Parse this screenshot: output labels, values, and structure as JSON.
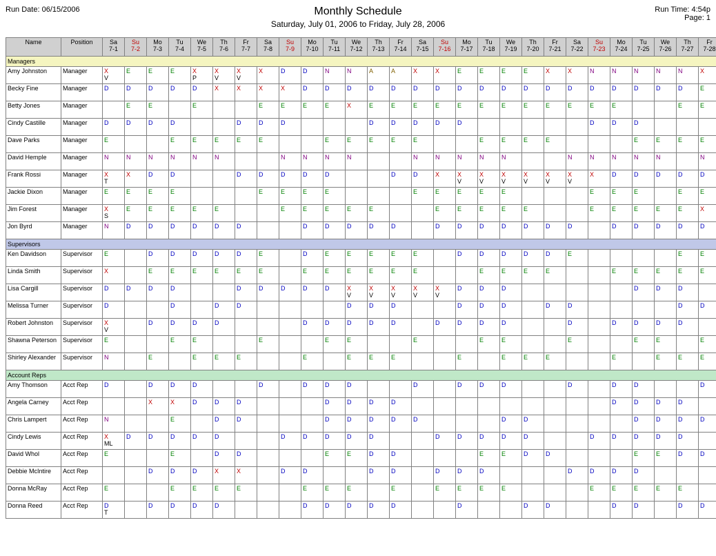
{
  "header": {
    "runDateLabel": "Run Date: 06/15/2006",
    "runTimeLabel": "Run Time: 4:54p",
    "pageLabel": "Page: 1",
    "title": "Monthly Schedule",
    "subtitle": "Saturday, July 01, 2006 to Friday, July 28, 2006"
  },
  "cols": {
    "name": "Name",
    "position": "Position"
  },
  "days": [
    {
      "dow": "Sa",
      "md": "7-1",
      "su": false
    },
    {
      "dow": "Su",
      "md": "7-2",
      "su": true
    },
    {
      "dow": "Mo",
      "md": "7-3",
      "su": false
    },
    {
      "dow": "Tu",
      "md": "7-4",
      "su": false
    },
    {
      "dow": "We",
      "md": "7-5",
      "su": false
    },
    {
      "dow": "Th",
      "md": "7-6",
      "su": false
    },
    {
      "dow": "Fr",
      "md": "7-7",
      "su": false
    },
    {
      "dow": "Sa",
      "md": "7-8",
      "su": false
    },
    {
      "dow": "Su",
      "md": "7-9",
      "su": true
    },
    {
      "dow": "Mo",
      "md": "7-10",
      "su": false
    },
    {
      "dow": "Tu",
      "md": "7-11",
      "su": false
    },
    {
      "dow": "We",
      "md": "7-12",
      "su": false
    },
    {
      "dow": "Th",
      "md": "7-13",
      "su": false
    },
    {
      "dow": "Fr",
      "md": "7-14",
      "su": false
    },
    {
      "dow": "Sa",
      "md": "7-15",
      "su": false
    },
    {
      "dow": "Su",
      "md": "7-16",
      "su": true
    },
    {
      "dow": "Mo",
      "md": "7-17",
      "su": false
    },
    {
      "dow": "Tu",
      "md": "7-18",
      "su": false
    },
    {
      "dow": "We",
      "md": "7-19",
      "su": false
    },
    {
      "dow": "Th",
      "md": "7-20",
      "su": false
    },
    {
      "dow": "Fr",
      "md": "7-21",
      "su": false
    },
    {
      "dow": "Sa",
      "md": "7-22",
      "su": false
    },
    {
      "dow": "Su",
      "md": "7-23",
      "su": true
    },
    {
      "dow": "Mo",
      "md": "7-24",
      "su": false
    },
    {
      "dow": "Tu",
      "md": "7-25",
      "su": false
    },
    {
      "dow": "We",
      "md": "7-26",
      "su": false
    },
    {
      "dow": "Th",
      "md": "7-27",
      "su": false
    },
    {
      "dow": "Fr",
      "md": "7-28",
      "su": false
    }
  ],
  "groups": [
    {
      "label": "Managers",
      "cls": "g0",
      "rows": [
        {
          "name": "Amy Johnston",
          "pos": "Manager",
          "c": [
            "X V",
            "E",
            "E",
            "E",
            "X P",
            "X V",
            "X V",
            "X",
            "D",
            "D",
            "N",
            "N",
            "A",
            "A",
            "X",
            "X",
            "E",
            "E",
            "E",
            "E",
            "X",
            "X",
            "N",
            "N",
            "N",
            "N",
            "N",
            "X"
          ]
        },
        {
          "name": "Becky Fine",
          "pos": "Manager",
          "c": [
            "D",
            "D",
            "D",
            "D",
            "D",
            "X",
            "X",
            "X",
            "X",
            "D",
            "D",
            "D",
            "D",
            "D",
            "D",
            "D",
            "D",
            "D",
            "D",
            "D",
            "D",
            "D",
            "D",
            "D",
            "D",
            "D",
            "D",
            "E"
          ]
        },
        {
          "name": "Betty Jones",
          "pos": "Manager",
          "c": [
            "",
            "E",
            "E",
            "",
            "E",
            "",
            "",
            "E",
            "E",
            "E",
            "E",
            "X",
            "E",
            "E",
            "E",
            "E",
            "E",
            "E",
            "E",
            "E",
            "E",
            "E",
            "E",
            "E",
            "",
            "",
            "E",
            "E"
          ]
        },
        {
          "name": "Cindy Castille",
          "pos": "Manager",
          "c": [
            "D",
            "D",
            "D",
            "D",
            "",
            "",
            "D",
            "D",
            "D",
            "",
            "",
            "",
            "D",
            "D",
            "D",
            "D",
            "D",
            "",
            "",
            "",
            "",
            "",
            "D",
            "D",
            "D",
            "",
            "",
            ""
          ]
        },
        {
          "name": "Dave Parks",
          "pos": "Manager",
          "c": [
            "E",
            "",
            "",
            "E",
            "E",
            "E",
            "E",
            "E",
            "",
            "",
            "E",
            "E",
            "E",
            "E",
            "E",
            "",
            "",
            "E",
            "E",
            "E",
            "E",
            "",
            "",
            "",
            "E",
            "E",
            "E",
            "E"
          ]
        },
        {
          "name": "David Hemple",
          "pos": "Manager",
          "c": [
            "N",
            "N",
            "N",
            "N",
            "N",
            "N",
            "",
            "",
            "N",
            "N",
            "N",
            "N",
            "",
            "",
            "N",
            "N",
            "N",
            "N",
            "N",
            "",
            "",
            "N",
            "N",
            "N",
            "N",
            "N",
            "",
            "N"
          ]
        },
        {
          "name": "Frank Rossi",
          "pos": "Manager",
          "c": [
            "X T",
            "X",
            "D",
            "D",
            "",
            "",
            "D",
            "D",
            "D",
            "D",
            "D",
            "",
            "",
            "D",
            "D",
            "X",
            "X V",
            "X V",
            "X V",
            "X V",
            "X V",
            "X V",
            "X",
            "D",
            "D",
            "D",
            "D",
            "D"
          ]
        },
        {
          "name": "Jackie Dixon",
          "pos": "Manager",
          "c": [
            "E",
            "E",
            "E",
            "E",
            "",
            "",
            "",
            "E",
            "E",
            "E",
            "E",
            "",
            "",
            "",
            "E",
            "E",
            "E",
            "E",
            "E",
            "",
            "",
            "",
            "E",
            "E",
            "E",
            "",
            "E",
            "E"
          ]
        },
        {
          "name": "Jim Forest",
          "pos": "Manager",
          "c": [
            "X S",
            "E",
            "E",
            "E",
            "E",
            "E",
            "",
            "",
            "E",
            "E",
            "E",
            "E",
            "E",
            "",
            "",
            "E",
            "E",
            "E",
            "E",
            "E",
            "",
            "",
            "E",
            "E",
            "E",
            "E",
            "E",
            "X"
          ]
        },
        {
          "name": "Jon Byrd",
          "pos": "Manager",
          "c": [
            "N",
            "D",
            "D",
            "D",
            "D",
            "D",
            "D",
            "",
            "",
            "D",
            "D",
            "D",
            "D",
            "D",
            "",
            "D",
            "D",
            "D",
            "D",
            "D",
            "D",
            "D",
            "",
            "D",
            "D",
            "D",
            "D",
            "D"
          ]
        }
      ]
    },
    {
      "label": "Supervisors",
      "cls": "g1",
      "rows": [
        {
          "name": "Ken Davidson",
          "pos": "Supervisor",
          "c": [
            "E",
            "",
            "D",
            "D",
            "D",
            "D",
            "D",
            "E",
            "",
            "D",
            "E",
            "E",
            "E",
            "E",
            "E",
            "",
            "D",
            "D",
            "D",
            "D",
            "D",
            "E",
            "",
            "",
            "",
            "",
            "E",
            "E"
          ]
        },
        {
          "name": "Linda Smith",
          "pos": "Supervisor",
          "c": [
            "X",
            "",
            "E",
            "E",
            "E",
            "E",
            "E",
            "E",
            "",
            "E",
            "E",
            "E",
            "E",
            "E",
            "E",
            "",
            "",
            "E",
            "E",
            "E",
            "E",
            "",
            "",
            "E",
            "E",
            "E",
            "E",
            "E"
          ]
        },
        {
          "name": "Lisa Cargill",
          "pos": "Supervisor",
          "c": [
            "D",
            "D",
            "D",
            "D",
            "",
            "",
            "D",
            "D",
            "D",
            "D",
            "D",
            "X V",
            "X V",
            "X V",
            "X V",
            "X V",
            "D",
            "D",
            "D",
            "",
            "",
            "",
            "",
            "",
            "D",
            "D",
            "D",
            ""
          ]
        },
        {
          "name": "Melissa Turner",
          "pos": "Supervisor",
          "c": [
            "D",
            "",
            "",
            "D",
            "",
            "D",
            "D",
            "",
            "",
            "",
            "",
            "D",
            "D",
            "D",
            "",
            "",
            "D",
            "D",
            "D",
            "",
            "D",
            "D",
            "",
            "",
            "",
            "",
            "D",
            "D"
          ]
        },
        {
          "name": "Robert Johnston",
          "pos": "Supervisor",
          "c": [
            "X V",
            "",
            "D",
            "D",
            "D",
            "D",
            "",
            "",
            "",
            "D",
            "D",
            "D",
            "D",
            "D",
            "",
            "D",
            "D",
            "D",
            "D",
            "",
            "",
            "D",
            "",
            "D",
            "D",
            "D",
            "D",
            ""
          ]
        },
        {
          "name": "Shawna Peterson",
          "pos": "Supervisor",
          "c": [
            "E",
            "",
            "",
            "E",
            "E",
            "",
            "",
            "E",
            "",
            "",
            "E",
            "E",
            "",
            "",
            "E",
            "",
            "",
            "E",
            "E",
            "",
            "",
            "E",
            "",
            "",
            "E",
            "E",
            "",
            "E"
          ]
        },
        {
          "name": "Shirley Alexander",
          "pos": "Supervisor",
          "c": [
            "N",
            "",
            "E",
            "",
            "E",
            "E",
            "E",
            "",
            "",
            "E",
            "",
            "E",
            "E",
            "E",
            "",
            "",
            "E",
            "",
            "E",
            "E",
            "E",
            "",
            "",
            "E",
            "",
            "E",
            "E",
            "E"
          ]
        }
      ]
    },
    {
      "label": "Account Reps",
      "cls": "g2",
      "rows": [
        {
          "name": "Amy Thomson",
          "pos": "Acct Rep",
          "c": [
            "D",
            "",
            "D",
            "D",
            "D",
            "",
            "",
            "D",
            "",
            "D",
            "D",
            "D",
            "",
            "",
            "D",
            "",
            "D",
            "D",
            "D",
            "",
            "",
            "D",
            "",
            "D",
            "D",
            "",
            "",
            "D"
          ]
        },
        {
          "name": "Angela Carney",
          "pos": "Acct Rep",
          "c": [
            "",
            "",
            "X",
            "X",
            "D",
            "D",
            "D",
            "",
            "",
            "",
            "D",
            "D",
            "D",
            "D",
            "",
            "",
            "",
            "",
            "",
            "",
            "",
            "",
            "",
            "D",
            "D",
            "D",
            "D",
            ""
          ]
        },
        {
          "name": "Chris Lampert",
          "pos": "Acct Rep",
          "c": [
            "N",
            "",
            "",
            "E",
            "",
            "D",
            "D",
            "",
            "",
            "",
            "D",
            "D",
            "D",
            "D",
            "D",
            "",
            "",
            "",
            "D",
            "D",
            "",
            "",
            "",
            "",
            "D",
            "D",
            "D",
            "D"
          ]
        },
        {
          "name": "Cindy Lewis",
          "pos": "Acct Rep",
          "c": [
            "X ML",
            "D",
            "D",
            "D",
            "D",
            "D",
            "",
            "",
            "D",
            "D",
            "D",
            "D",
            "D",
            "",
            "",
            "D",
            "D",
            "D",
            "D",
            "D",
            "",
            "",
            "D",
            "D",
            "D",
            "D",
            "D",
            ""
          ]
        },
        {
          "name": "David Whol",
          "pos": "Acct Rep",
          "c": [
            "E",
            "",
            "",
            "E",
            "",
            "D",
            "D",
            "",
            "",
            "",
            "E",
            "E",
            "D",
            "D",
            "",
            "",
            "",
            "E",
            "E",
            "D",
            "D",
            "",
            "",
            "",
            "E",
            "E",
            "D",
            "D"
          ]
        },
        {
          "name": "Debbie McIntire",
          "pos": "Acct Rep",
          "c": [
            "",
            "",
            "D",
            "D",
            "D",
            "X",
            "X",
            "",
            "D",
            "D",
            "",
            "",
            "D",
            "D",
            "",
            "D",
            "D",
            "D",
            "",
            "",
            "",
            "D",
            "D",
            "D",
            "D",
            "",
            "",
            ""
          ]
        },
        {
          "name": "Donna McRay",
          "pos": "Acct Rep",
          "c": [
            "E",
            "",
            "",
            "E",
            "E",
            "E",
            "E",
            "",
            "",
            "E",
            "E",
            "E",
            "",
            "E",
            "",
            "E",
            "E",
            "E",
            "E",
            "",
            "",
            "",
            "E",
            "E",
            "E",
            "E",
            "E",
            ""
          ]
        },
        {
          "name": "Donna Reed",
          "pos": "Acct Rep",
          "c": [
            "D T",
            "",
            "D",
            "D",
            "D",
            "D",
            "",
            "",
            "",
            "D",
            "D",
            "D",
            "D",
            "D",
            "",
            "",
            "D",
            "",
            "",
            "D",
            "D",
            "",
            "",
            "D",
            "D",
            "",
            "D",
            "D"
          ]
        }
      ]
    }
  ]
}
